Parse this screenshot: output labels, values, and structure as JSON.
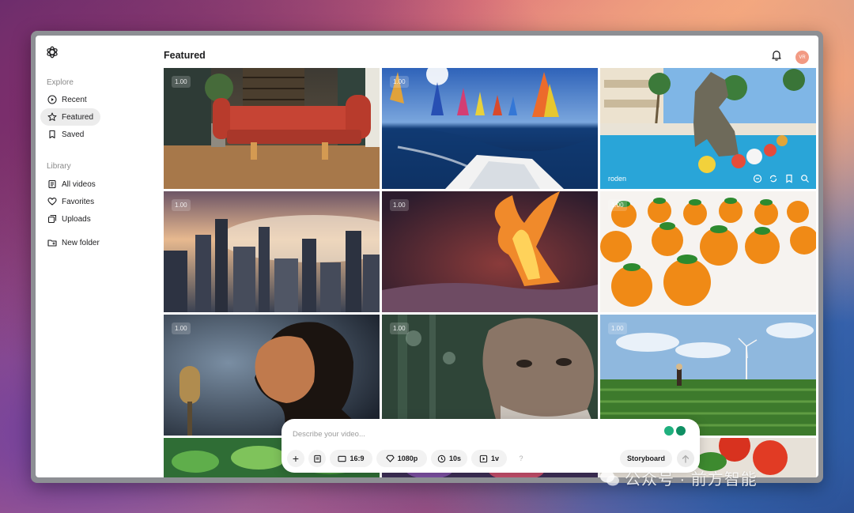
{
  "header": {
    "title": "Featured"
  },
  "sidebar": {
    "explore_label": "Explore",
    "explore_items": [
      {
        "label": "Recent",
        "icon": "play-circle-icon"
      },
      {
        "label": "Featured",
        "icon": "star-icon",
        "active": true
      },
      {
        "label": "Saved",
        "icon": "bookmark-icon"
      }
    ],
    "library_label": "Library",
    "library_items": [
      {
        "label": "All videos",
        "icon": "video-list-icon"
      },
      {
        "label": "Favorites",
        "icon": "heart-icon"
      },
      {
        "label": "Uploads",
        "icon": "uploads-icon"
      }
    ],
    "new_folder": "New folder"
  },
  "user": {
    "avatar_initials": "VR"
  },
  "tiles": [
    {
      "duration": "1.00",
      "scene": "red sofa"
    },
    {
      "duration": "1.00",
      "scene": "sailboats"
    },
    {
      "duration": "",
      "scene": "dinosaur pool",
      "author": "roden"
    },
    {
      "duration": "1.00",
      "scene": "city fog"
    },
    {
      "duration": "1.00",
      "scene": "phoenix"
    },
    {
      "duration": "1.00",
      "scene": "oranges"
    },
    {
      "duration": "1.00",
      "scene": "singer"
    },
    {
      "duration": "1.00",
      "scene": "old man"
    },
    {
      "duration": "1.00",
      "scene": "wind farm"
    }
  ],
  "composer": {
    "placeholder": "Describe your video...",
    "aspect_ratio": "16:9",
    "resolution": "1080p",
    "duration": "10s",
    "variations": "1v",
    "help": "?",
    "storyboard": "Storyboard"
  },
  "watermark": "公众号 · 前方智能",
  "colors": {
    "accent_green": "#16a36b",
    "avatar": "#f29a83"
  }
}
